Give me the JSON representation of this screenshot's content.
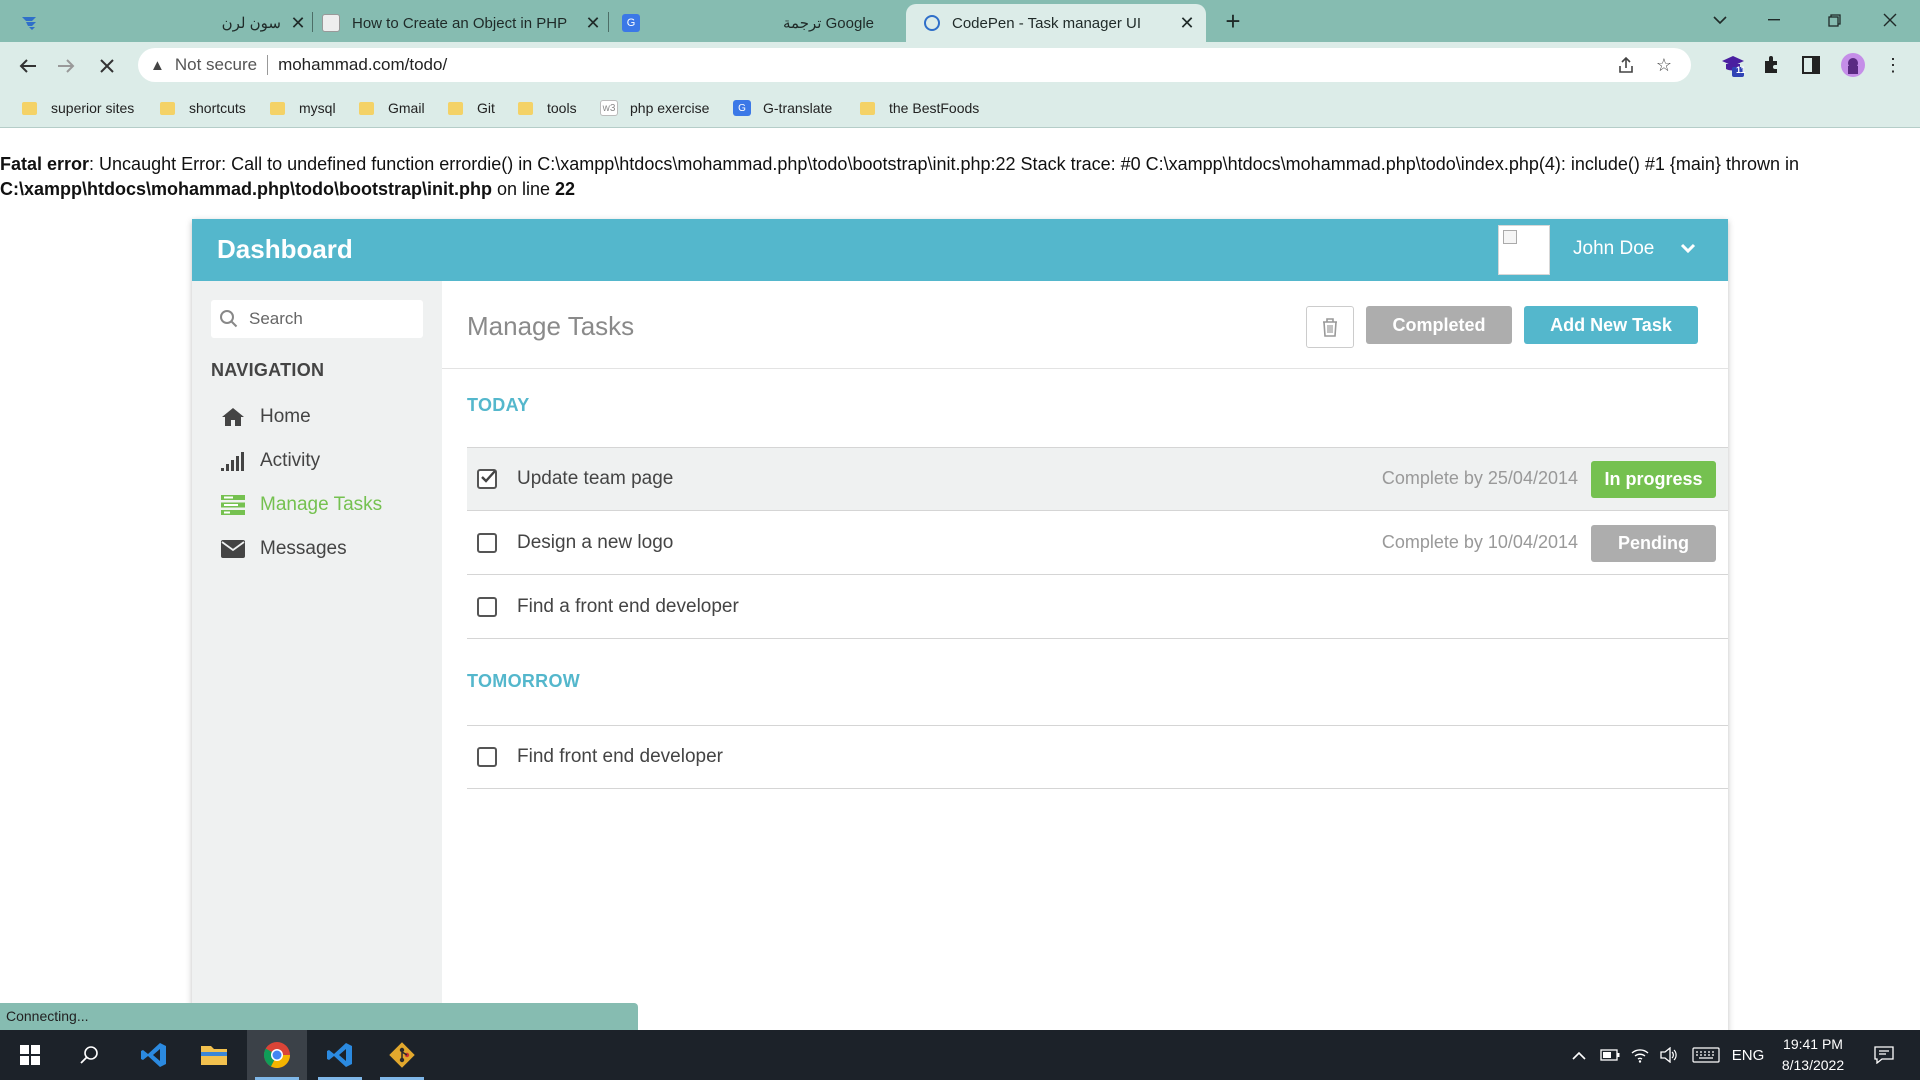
{
  "browser": {
    "tabs": [
      {
        "title": "سون لرن",
        "active": false
      },
      {
        "title": "How to Create an Object in PHP",
        "active": false
      },
      {
        "title": "ترجمة Google",
        "active": false
      },
      {
        "title": "CodePen - Task manager UI",
        "active": true
      }
    ],
    "address": {
      "security_label": "Not secure",
      "url": "mohammad.com/todo/"
    },
    "extension_badge": "11",
    "bookmarks": [
      {
        "label": "superior sites",
        "icon": "folder-icon"
      },
      {
        "label": "shortcuts",
        "icon": "folder-icon"
      },
      {
        "label": "mysql",
        "icon": "folder-icon"
      },
      {
        "label": "Gmail",
        "icon": "folder-icon"
      },
      {
        "label": "Git",
        "icon": "folder-icon"
      },
      {
        "label": "tools",
        "icon": "folder-icon"
      },
      {
        "label": "php exercise",
        "icon": "w3schools-icon"
      },
      {
        "label": "G-translate",
        "icon": "google-translate-icon"
      },
      {
        "label": "the BestFoods",
        "icon": "folder-icon"
      }
    ],
    "status": "Connecting..."
  },
  "error": {
    "label": "Fatal error",
    "message": ": Uncaught Error: Call to undefined function errordie() in C:\\xampp\\htdocs\\mohammad.php\\todo\\bootstrap\\init.php:22 Stack trace: #0 C:\\xampp\\htdocs\\mohammad.php\\todo\\index.php(4): include() #1 {main} thrown in ",
    "file": "C:\\xampp\\htdocs\\mohammad.php\\todo\\bootstrap\\init.php",
    "on_line": " on line ",
    "line": "22"
  },
  "dashboard": {
    "title": "Dashboard",
    "user_name": "John Doe",
    "search_placeholder": "Search",
    "nav_heading": "NAVIGATION",
    "nav": [
      {
        "label": "Home",
        "icon": "home-icon",
        "active": false
      },
      {
        "label": "Activity",
        "icon": "signal-bars-icon",
        "active": false
      },
      {
        "label": "Manage Tasks",
        "icon": "tasks-icon",
        "active": true
      },
      {
        "label": "Messages",
        "icon": "envelope-icon",
        "active": false
      }
    ],
    "page_title": "Manage Tasks",
    "completed_button": "Completed",
    "add_button": "Add New Task",
    "sections": [
      {
        "label": "TODAY",
        "tasks": [
          {
            "name": "Update team page",
            "checked": true,
            "due": "Complete by 25/04/2014",
            "status": "In progress",
            "status_color": "#75c150"
          },
          {
            "name": "Design a new logo",
            "checked": false,
            "due": "Complete by 10/04/2014",
            "status": "Pending",
            "status_color": "#adadad"
          },
          {
            "name": "Find a front end developer",
            "checked": false,
            "due": "",
            "status": "",
            "status_color": ""
          }
        ]
      },
      {
        "label": "TOMORROW",
        "tasks": [
          {
            "name": "Find front end developer",
            "checked": false,
            "due": "",
            "status": "",
            "status_color": ""
          }
        ]
      }
    ]
  },
  "taskbar": {
    "language": "ENG",
    "time": "19:41 PM",
    "date": "8/13/2022"
  },
  "colors": {
    "accent": "#54b7cc",
    "active_nav": "#75c150",
    "chrome": "#86bcb1"
  }
}
